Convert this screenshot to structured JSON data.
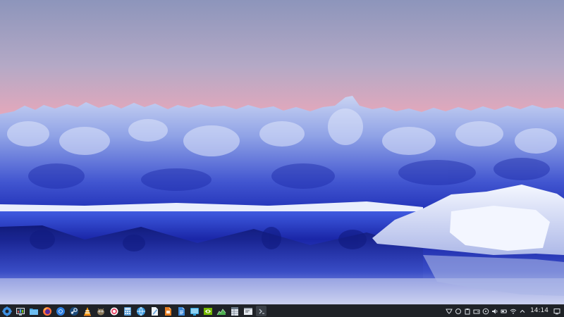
{
  "wallpaper": {
    "description_icon": "snowy-forest-lake-wallpaper",
    "colors": {
      "sky_top": "#8f97bd",
      "sky_bottom": "#e6aabb",
      "forest": "#3a4fd0",
      "snow": "#eaf0ff",
      "water": "#1a2cb8"
    }
  },
  "taskbar": {
    "background": "#1f2227",
    "launchers": [
      {
        "name": "application-launcher-icon",
        "color": "#3d8fe0"
      },
      {
        "name": "system-monitor-icon",
        "color": "#c84a4a"
      },
      {
        "name": "file-manager-icon",
        "color": "#4aa3df"
      },
      {
        "name": "firefox-icon",
        "color": "#ff7139"
      },
      {
        "name": "chromium-icon",
        "color": "#2f7fe0"
      },
      {
        "name": "steam-icon",
        "color": "#5a8fd0"
      },
      {
        "name": "vlc-icon",
        "color": "#f39c12"
      },
      {
        "name": "gimp-icon",
        "color": "#8a7a5c"
      },
      {
        "name": "screen-recorder-icon",
        "color": "#e84a6a"
      },
      {
        "name": "calculator-icon",
        "color": "#5a9fd8"
      },
      {
        "name": "browser-icon",
        "color": "#3a9ae0"
      },
      {
        "name": "text-editor-icon",
        "color": "#6fa8dc"
      },
      {
        "name": "presentation-icon",
        "color": "#e67e22"
      },
      {
        "name": "document-icon",
        "color": "#3b87d8"
      },
      {
        "name": "remote-desktop-icon",
        "color": "#2e9fd8"
      },
      {
        "name": "nvidia-settings-icon",
        "color": "#76b900"
      },
      {
        "name": "chart-monitor-icon",
        "color": "#4caf50"
      },
      {
        "name": "spreadsheet-icon",
        "color": "#6c7a89"
      },
      {
        "name": "terminal-window-icon",
        "color": "#9aa3ad"
      },
      {
        "name": "terminal-icon",
        "color": "#7f8a94"
      }
    ],
    "tray": [
      {
        "name": "steam-tray-icon"
      },
      {
        "name": "sync-tray-icon"
      },
      {
        "name": "clipboard-tray-icon"
      },
      {
        "name": "storage-tray-icon"
      },
      {
        "name": "update-tray-icon"
      },
      {
        "name": "volume-icon"
      },
      {
        "name": "battery-icon"
      },
      {
        "name": "wifi-icon"
      },
      {
        "name": "expand-tray-icon"
      }
    ],
    "clock": "14:14"
  }
}
